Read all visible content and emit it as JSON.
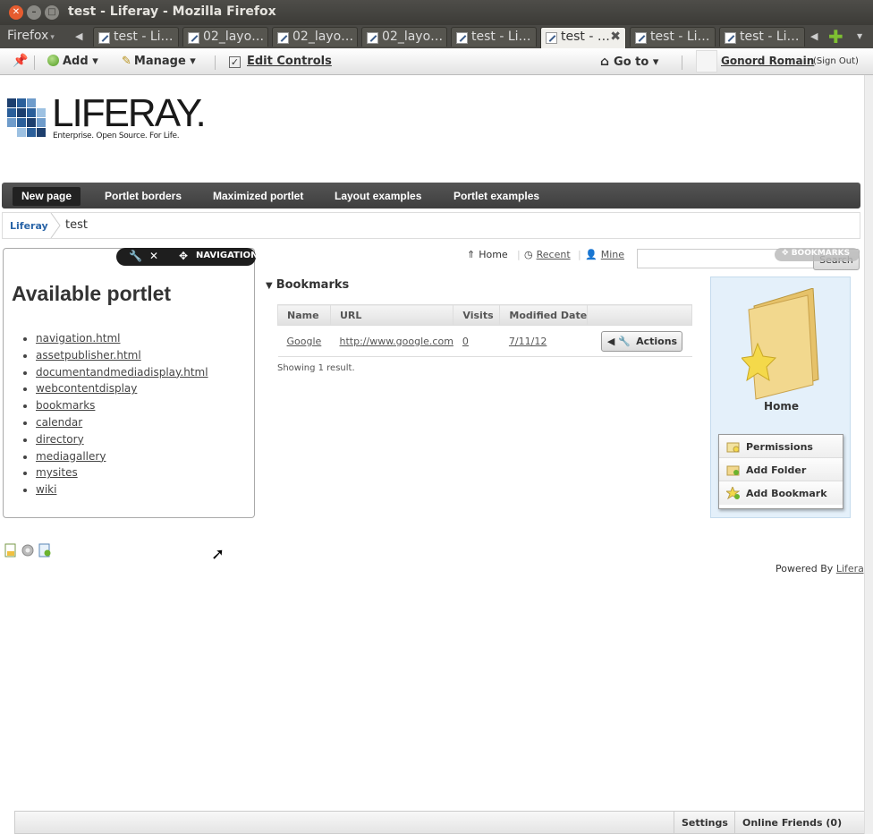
{
  "window": {
    "title": "test - Liferay - Mozilla Firefox"
  },
  "browser": {
    "menu_label": "Firefox",
    "tabs": [
      {
        "label": "test - Li…"
      },
      {
        "label": "02_layo…"
      },
      {
        "label": "02_layo…"
      },
      {
        "label": "02_layo…"
      },
      {
        "label": "test - Li…"
      },
      {
        "label": "test - …"
      },
      {
        "label": "test - Li…"
      },
      {
        "label": "test - Li…"
      }
    ]
  },
  "dockbar": {
    "add_label": "Add",
    "manage_label": "Manage",
    "edit_controls_label": "Edit Controls",
    "goto_label": "Go to",
    "user_name": "Gonord Romain",
    "sign_out_label": "(Sign Out)"
  },
  "logo": {
    "wordmark": "LIFERAY.",
    "tagline": "Enterprise. Open Source. For Life."
  },
  "nav": {
    "items": [
      {
        "label": "New page"
      },
      {
        "label": "Portlet borders"
      },
      {
        "label": "Maximized portlet"
      },
      {
        "label": "Layout examples"
      },
      {
        "label": "Portlet examples"
      }
    ]
  },
  "breadcrumb": {
    "root": "Liferay",
    "current": "test"
  },
  "nav_portlet": {
    "bar_label": "NAVIGATION",
    "title": "Available portlet",
    "links": [
      "navigation.html",
      "assetpublisher.html",
      "documentandmediadisplay.html",
      "webcontentdisplay",
      "bookmarks",
      "calendar",
      "directory",
      "mediagallery",
      "mysites",
      "wiki"
    ]
  },
  "bookmarks": {
    "top_links": {
      "home": "Home",
      "recent": "Recent",
      "mine": "Mine"
    },
    "search_button": "Search",
    "portlet_tag": "BOOKMARKS",
    "title": "Bookmarks",
    "columns": [
      "Name",
      "URL",
      "Visits",
      "Modified Date",
      ""
    ],
    "rows": [
      {
        "name": "Google",
        "url": "http://www.google.com",
        "visits": "0",
        "modified": "7/11/12",
        "action": "Actions"
      }
    ],
    "showing": "Showing 1 result."
  },
  "folder": {
    "name": "Home",
    "menu": [
      {
        "label": "Permissions"
      },
      {
        "label": "Add Folder"
      },
      {
        "label": "Add Bookmark"
      }
    ]
  },
  "footer": {
    "powered_by": "Powered By",
    "powered_link": "Liferay"
  },
  "chatbar": {
    "settings": "Settings",
    "friends": "Online Friends (0)"
  }
}
